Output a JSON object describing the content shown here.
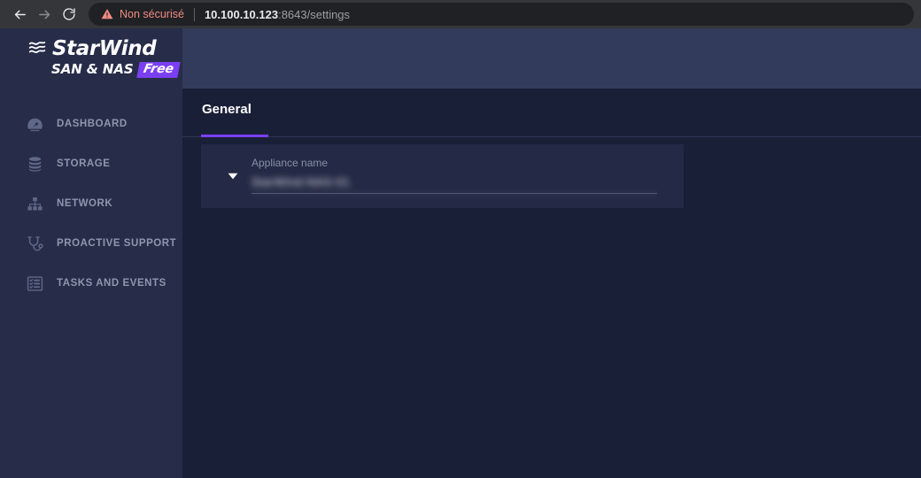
{
  "browser": {
    "back_icon": "arrow-left-icon",
    "forward_icon": "arrow-right-icon",
    "reload_icon": "reload-icon",
    "security_warning_icon": "warning-triangle-icon",
    "security_label": "Non sécurisé",
    "url_host": "10.100.10.123",
    "url_rest": ":8643/settings",
    "url_full": "10.100.10.123:8643/settings",
    "colors": {
      "toolbar_bg": "#35363a",
      "omnibox_bg": "#202124",
      "insecure_text": "#f28b82",
      "host_text": "#e8eaed",
      "path_text": "#9aa0a6"
    }
  },
  "sidebar": {
    "logo": {
      "wave_icon": "wave-logo-icon",
      "name": "StarWind",
      "subtitle": "SAN & NAS",
      "badge": "Free",
      "badge_color": "#7b3ff2"
    },
    "items": [
      {
        "label": "DASHBOARD",
        "icon": "gauge-icon"
      },
      {
        "label": "STORAGE",
        "icon": "database-stack-icon"
      },
      {
        "label": "NETWORK",
        "icon": "sitemap-icon"
      },
      {
        "label": "PROACTIVE SUPPORT",
        "icon": "stethoscope-icon"
      },
      {
        "label": "TASKS AND EVENTS",
        "icon": "checklist-icon"
      }
    ],
    "bg_color": "#272d49",
    "label_color": "#8e96ad"
  },
  "main": {
    "topbar_color": "#333b5c",
    "content_bg": "#1a1f38",
    "tabs": [
      {
        "label": "General",
        "active": true
      }
    ],
    "accent_color": "#7b3ff2",
    "settings_card": {
      "expand_icon": "caret-down-icon",
      "field_label": "Appliance name",
      "field_value": "StarWind-NAS-01",
      "field_placeholder": "Appliance name",
      "field_redacted": true,
      "card_bg": "#242a45"
    }
  }
}
